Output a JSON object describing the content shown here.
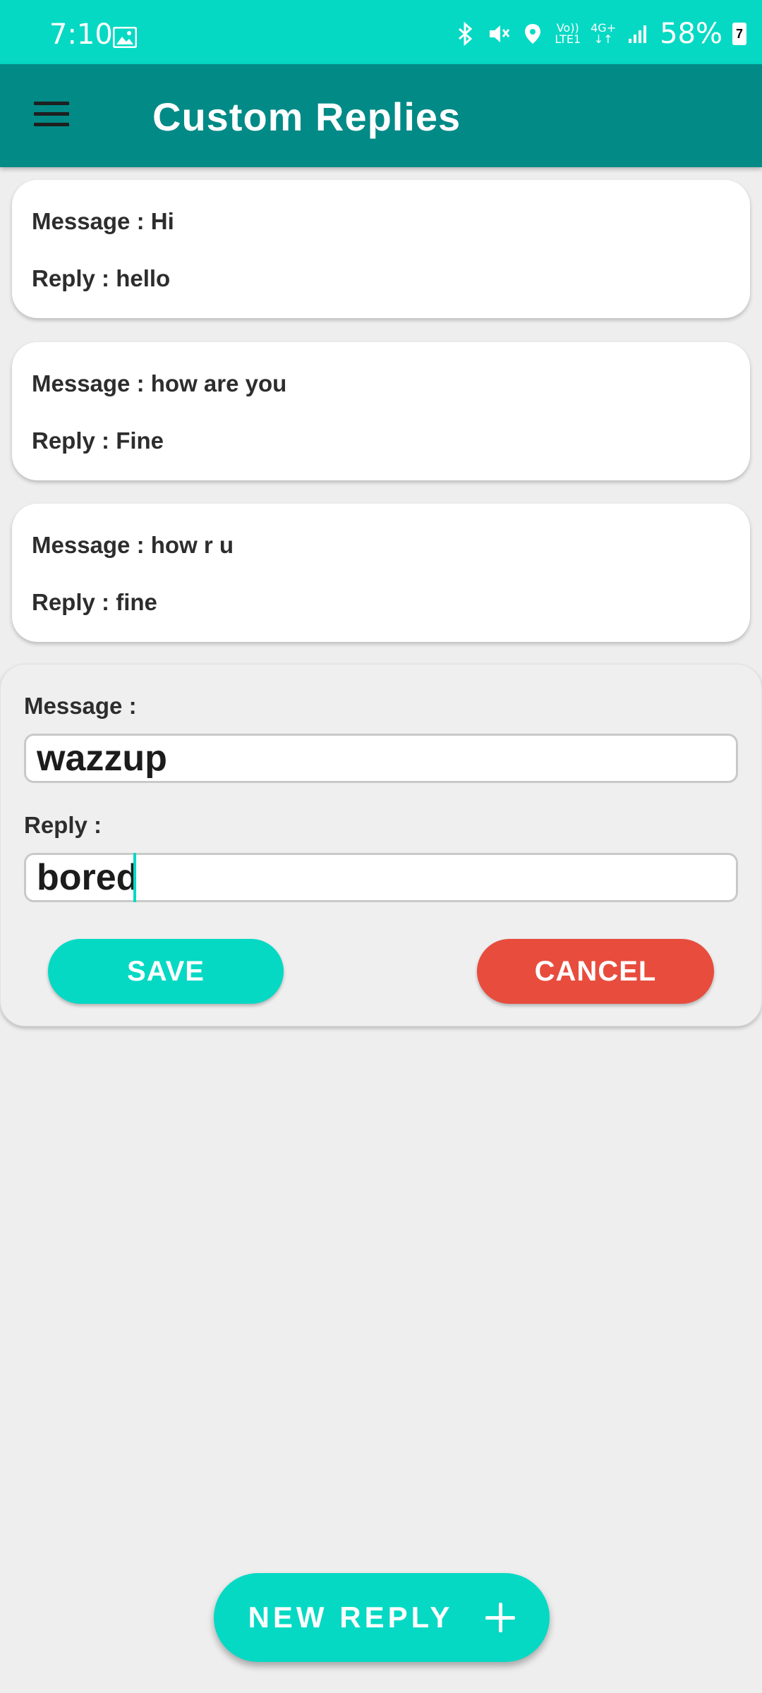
{
  "status_bar": {
    "time": "7:10",
    "network_label_top": "Vo))",
    "network_label_bottom": "LTE1",
    "network_type": "4G+",
    "battery_percent": "58%",
    "battery_icon_digit": "7",
    "icons": [
      "gallery-icon",
      "bluetooth-icon",
      "mute-icon",
      "location-icon",
      "signal-icon",
      "battery-icon"
    ]
  },
  "app_bar": {
    "title": "Custom Replies",
    "menu_icon": "hamburger-menu-icon"
  },
  "replies": [
    {
      "message_label": "Message : ",
      "message": "Hi",
      "reply_label": "Reply : ",
      "reply": "hello"
    },
    {
      "message_label": "Message : ",
      "message": "how are you",
      "reply_label": "Reply : ",
      "reply": "Fine"
    },
    {
      "message_label": "Message : ",
      "message": "how r u",
      "reply_label": "Reply : ",
      "reply": "fine"
    }
  ],
  "form": {
    "message_label": "Message :",
    "message_value": "wazzup",
    "reply_label": "Reply :",
    "reply_value": "bored",
    "save_label": "SAVE",
    "cancel_label": "CANCEL"
  },
  "fab": {
    "label": "NEW REPLY",
    "icon": "plus-icon"
  },
  "colors": {
    "status_bar": "#05d9c4",
    "app_bar": "#018a86",
    "accent": "#05d9c4",
    "cancel": "#e84c3d",
    "background": "#eeeeee"
  }
}
